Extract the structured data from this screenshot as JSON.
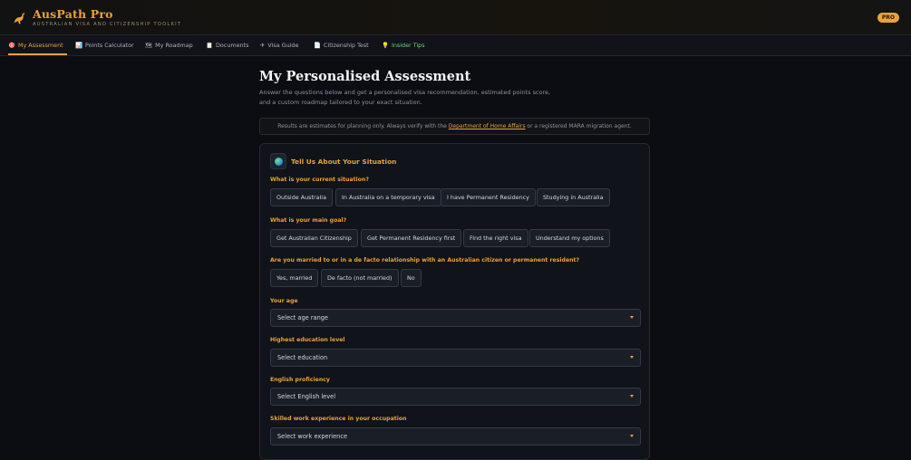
{
  "header": {
    "brand": "AusPath Pro",
    "tagline": "AUSTRALIAN VISA AND CITIZENSHIP TOOLKIT",
    "badge": "PRO"
  },
  "nav": {
    "tabs": [
      {
        "label": "My Assessment",
        "icon": "🎯"
      },
      {
        "label": "Points Calculator",
        "icon": "📊"
      },
      {
        "label": "My Roadmap",
        "icon": "🗺"
      },
      {
        "label": "Documents",
        "icon": "📋"
      },
      {
        "label": "Visa Guide",
        "icon": "✈"
      },
      {
        "label": "Citizenship Test",
        "icon": "📄"
      },
      {
        "label": "Insider Tips",
        "icon": "💡"
      }
    ]
  },
  "main": {
    "title": "My Personalised Assessment",
    "description": "Answer the questions below and get a personalised visa recommendation, estimated points score, and a custom roadmap tailored to your exact situation.",
    "notice": {
      "before": "Results are estimates for planning only. Always verify with the ",
      "link": "Department of Home Affairs",
      "after": " or a registered MARA migration agent."
    }
  },
  "card": {
    "title": "Tell Us About Your Situation",
    "questions": [
      {
        "label": "What is your current situation?",
        "options": [
          "Outside Australia",
          "In Australia on a temporary visa",
          "I have Permanent Residency",
          "Studying in Australia"
        ]
      },
      {
        "label": "What is your main goal?",
        "options": [
          "Get Australian Citizenship",
          "Get Permanent Residency first",
          "Find the right visa",
          "Understand my options"
        ]
      },
      {
        "label": "Are you married to or in a de facto relationship with an Australian citizen or permanent resident?",
        "options": [
          "Yes, married",
          "De facto (not married)",
          "No"
        ]
      }
    ],
    "selects": [
      {
        "label": "Your age",
        "value": "Select age range"
      },
      {
        "label": "Highest education level",
        "value": "Select education"
      },
      {
        "label": "English proficiency",
        "value": "Select English level"
      },
      {
        "label": "Skilled work experience in your occupation",
        "value": "Select work experience"
      }
    ]
  },
  "colors": {
    "accent": "#e8a23c",
    "tips": "#6fd67a",
    "background": "#0b0d12"
  }
}
